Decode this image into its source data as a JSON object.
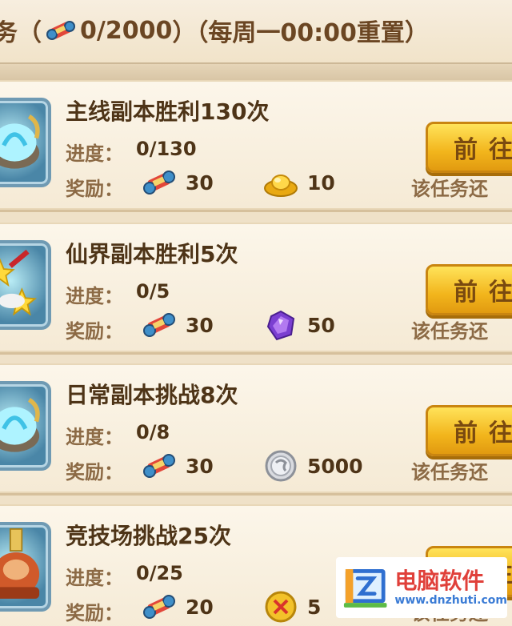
{
  "header": {
    "prefix": "务（",
    "progress": "0/2000",
    "suffix": "）（每周一00:00重置）",
    "icon": "scroll-icon"
  },
  "tasks": [
    {
      "title": "主线副本胜利130次",
      "progress_label": "进度：",
      "progress_value": "0/130",
      "reward_label": "奖励：",
      "reward1": {
        "icon": "scroll-icon",
        "amount": "30"
      },
      "reward2": {
        "icon": "gold-ingot-icon",
        "amount": "10"
      },
      "button_label": "前往",
      "status": "该任务还"
    },
    {
      "title": "仙界副本胜利5次",
      "progress_label": "进度：",
      "progress_value": "0/5",
      "reward_label": "奖励：",
      "reward1": {
        "icon": "scroll-icon",
        "amount": "30"
      },
      "reward2": {
        "icon": "purple-gem-icon",
        "amount": "50"
      },
      "button_label": "前往",
      "status": "该任务还"
    },
    {
      "title": "日常副本挑战8次",
      "progress_label": "进度：",
      "progress_value": "0/8",
      "reward_label": "奖励：",
      "reward1": {
        "icon": "scroll-icon",
        "amount": "30"
      },
      "reward2": {
        "icon": "silver-coin-icon",
        "amount": "5000"
      },
      "button_label": "前往",
      "status": "该任务还"
    },
    {
      "title": "竞技场挑战25次",
      "progress_label": "进度：",
      "progress_value": "0/25",
      "reward_label": "奖励：",
      "reward1": {
        "icon": "scroll-icon",
        "amount": "20"
      },
      "reward2": {
        "icon": "medal-icon",
        "amount": "5"
      },
      "button_label": "前往",
      "status": "该任务还"
    }
  ],
  "watermark": {
    "title": "电脑软件",
    "url": "www.dnzhuti.com"
  },
  "colors": {
    "background": "#efe1c8",
    "card": "#fcf6ea",
    "title_text": "#4e3417",
    "label_text": "#8c6a45",
    "button": "#f2b51c"
  }
}
